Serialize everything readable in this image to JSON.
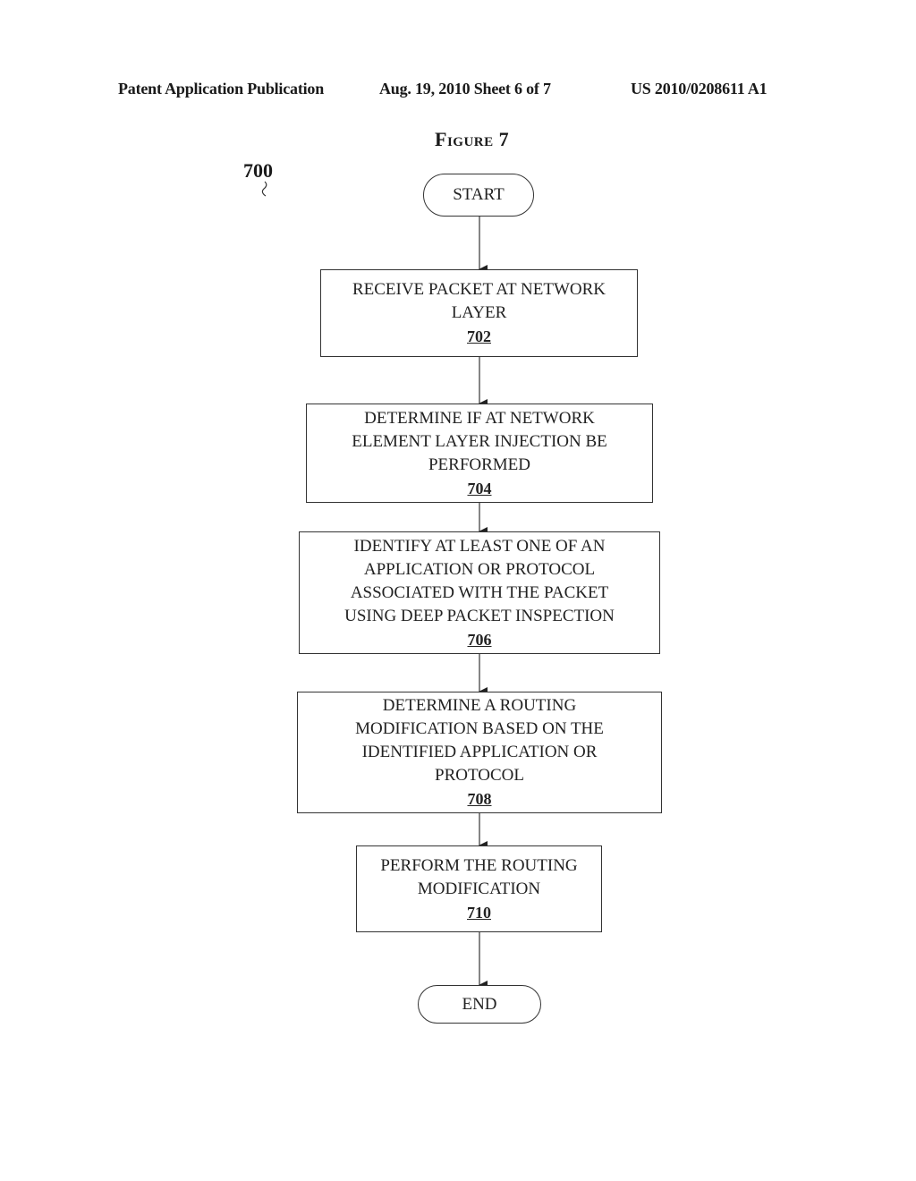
{
  "header": {
    "publication": "Patent Application Publication",
    "date_sheet": "Aug. 19, 2010  Sheet 6 of 7",
    "patent_number": "US 2010/0208611 A1"
  },
  "figure": {
    "title": "Figure 7",
    "reference": "700"
  },
  "flow": {
    "start": "START",
    "steps": [
      {
        "text": "RECEIVE PACKET AT NETWORK\nLAYER",
        "number": "702"
      },
      {
        "text": "DETERMINE IF AT NETWORK\nELEMENT  LAYER INJECTION BE\nPERFORMED",
        "number": "704"
      },
      {
        "text": "IDENTIFY AT LEAST ONE OF AN\nAPPLICATION OR PROTOCOL\nASSOCIATED WITH THE PACKET\nUSING DEEP PACKET INSPECTION",
        "number": "706"
      },
      {
        "text": "DETERMINE A ROUTING\nMODIFICATION BASED ON THE\nIDENTIFIED APPLICATION OR\nPROTOCOL",
        "number": "708"
      },
      {
        "text": "PERFORM THE ROUTING\nMODIFICATION",
        "number": "710"
      }
    ],
    "end": "END"
  }
}
